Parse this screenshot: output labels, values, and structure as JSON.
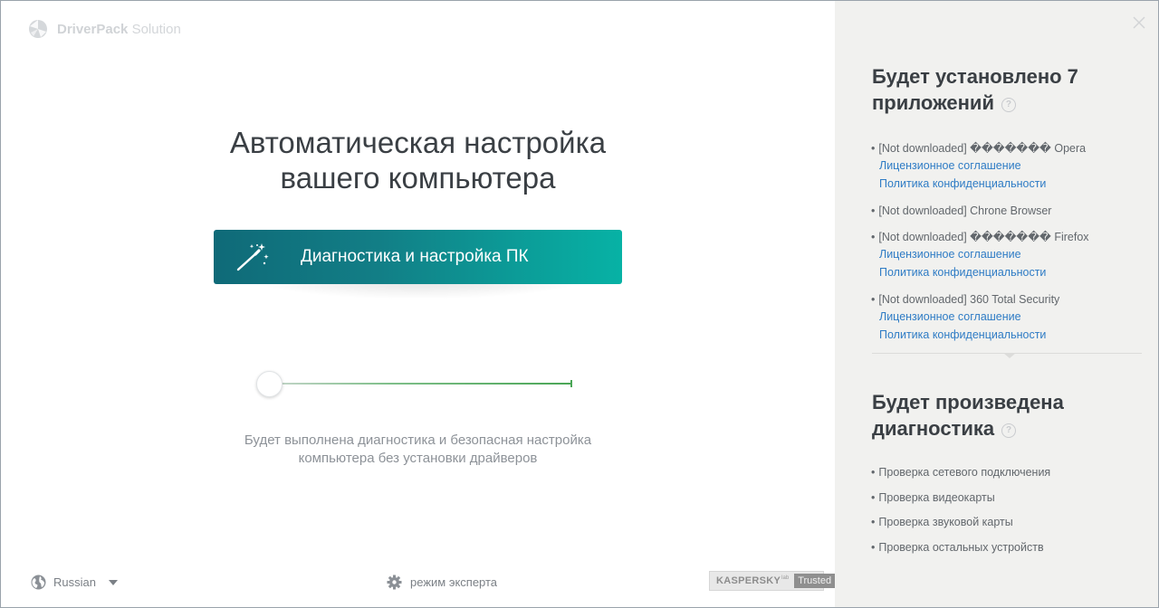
{
  "brand": {
    "name_bold": "DriverPack",
    "name_rest": "Solution"
  },
  "main": {
    "headline_line1": "Автоматическая настройка",
    "headline_line2": "вашего компьютера",
    "cta_label": "Диагностика и настройка ПК",
    "cta_icon": "magic-wand-icon",
    "description_line1": "Будет выполнена диагностика и безопасная настройка",
    "description_line2": "компьютера без установки драйверов",
    "slider_value": 0,
    "slider_accent": "#4aa656"
  },
  "footer": {
    "language": "Russian",
    "expert_mode": "режим эксперта",
    "kaspersky_name": "KASPERSKY",
    "kaspersky_lab": "lab",
    "kaspersky_trusted": "Trusted"
  },
  "sidebar": {
    "install_title_line1": "Будет установлено 7",
    "install_title_line2": "приложений",
    "help_glyph": "?",
    "bullet": "•",
    "apps": [
      {
        "name": "[Not downloaded] ������� Opera",
        "license": "Лицензионное соглашение",
        "privacy": "Политика конфиденциальности"
      },
      {
        "name": "[Not downloaded] Chrone Browser"
      },
      {
        "name": "[Not downloaded] ������� Firefox",
        "license": "Лицензионное соглашение",
        "privacy": "Политика конфиденциальности"
      },
      {
        "name": "[Not downloaded] 360 Total Security",
        "license": "Лицензионное соглашение",
        "privacy": "Политика конфиденциальности"
      }
    ],
    "diag_title_line1": "Будет произведена",
    "diag_title_line2": "диагностика",
    "checks": [
      "Проверка сетевого подключения",
      "Проверка видеокарты",
      "Проверка звуковой карты",
      "Проверка остальных устройств"
    ]
  },
  "colors": {
    "cta_start": "#0f6a78",
    "cta_end": "#07b2a5",
    "link": "#2f7cc5",
    "sidebar_bg": "#f1f1ef"
  }
}
